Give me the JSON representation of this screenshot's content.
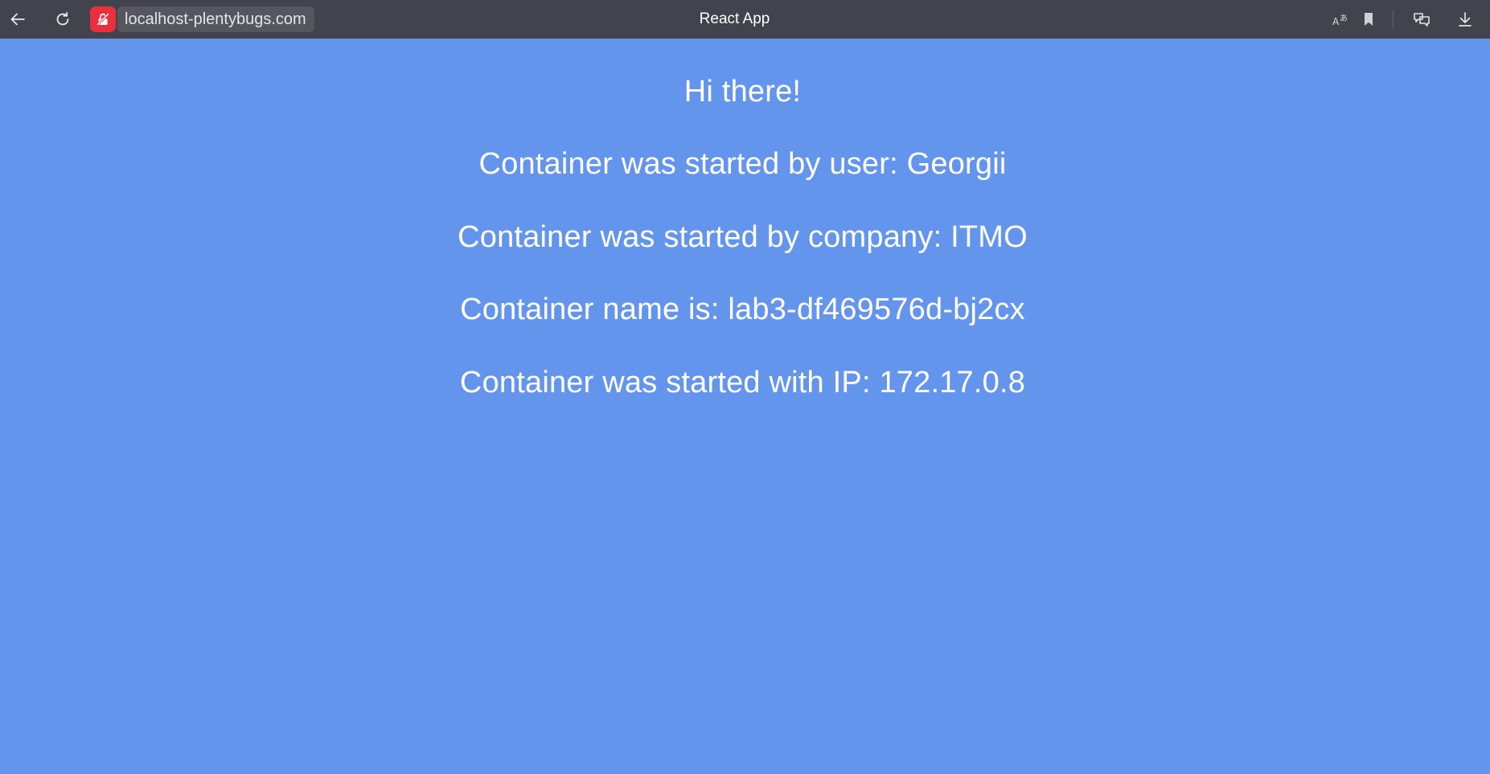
{
  "browser": {
    "tab_title": "React App",
    "url": "localhost-plentybugs.com",
    "icons": {
      "back": "arrow-left-icon",
      "reload": "reload-icon",
      "security": "unlocked-warning-icon",
      "translate": "translate-icon",
      "bookmark": "bookmark-icon",
      "tabs": "chat-tabs-icon",
      "download": "download-icon"
    },
    "colors": {
      "toolbar": "#42434c",
      "security_badge": "#e8303f"
    }
  },
  "page": {
    "background": "#6495ed",
    "greeting": "Hi there!",
    "user_line": "Container was started by user: Georgii",
    "company_line": "Container was started by company: ITMO",
    "name_line": "Container name is: lab3-df469576d-bj2cx",
    "ip_line": "Container was started with IP: 172.17.0.8"
  }
}
